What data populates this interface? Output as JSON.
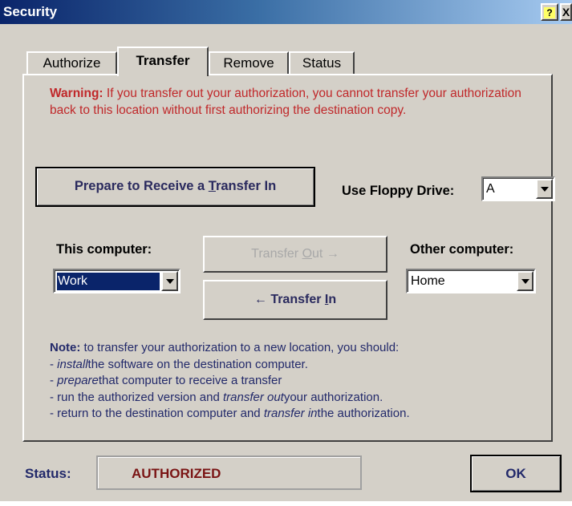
{
  "window": {
    "title": "Security",
    "help_glyph": "?",
    "close_glyph": "X"
  },
  "tabs": [
    {
      "label": "Authorize",
      "active": false
    },
    {
      "label": "Transfer",
      "active": true
    },
    {
      "label": "Remove",
      "active": false
    },
    {
      "label": "Status",
      "active": false
    }
  ],
  "warning": {
    "lead": "Warning:",
    "text": " If you transfer out your authorization, you cannot transfer your authorization back to this location without first authorizing the destination copy."
  },
  "prepare_button": {
    "before": "Prepare to Receive a ",
    "mnemonic": "T",
    "after": "ransfer In"
  },
  "floppy": {
    "label": "Use Floppy Drive:",
    "value": "A"
  },
  "this_computer": {
    "label": "This computer:",
    "value": "Work"
  },
  "other_computer": {
    "label": "Other computer:",
    "value": "Home"
  },
  "transfer_out_button": {
    "before": "Transfer ",
    "mnemonic": "O",
    "after": "ut",
    "arrow": "→",
    "enabled": false
  },
  "transfer_in_button": {
    "arrow": "←",
    "before": "Transfer ",
    "mnemonic": "I",
    "after": "n",
    "enabled": true
  },
  "note": {
    "lead": "Note:",
    "intro": " to transfer your authorization to a new location, you should:",
    "steps": [
      {
        "pre": "- ",
        "em": "install",
        "post": "the software on the destination computer."
      },
      {
        "pre": "- ",
        "em": "prepare",
        "post": "that computer to receive a transfer"
      },
      {
        "pre": "- run the authorized version and ",
        "em": "transfer out",
        "post": "your authorization."
      },
      {
        "pre": "- return to the destination computer and ",
        "em": "transfer in",
        "post": "the authorization."
      }
    ]
  },
  "status": {
    "label": "Status:",
    "value": "AUTHORIZED"
  },
  "ok_button": "OK",
  "colors": {
    "warning": "#c0282a",
    "note": "#22296a",
    "status_value": "#7a1414",
    "face": "#d4d0c8"
  }
}
